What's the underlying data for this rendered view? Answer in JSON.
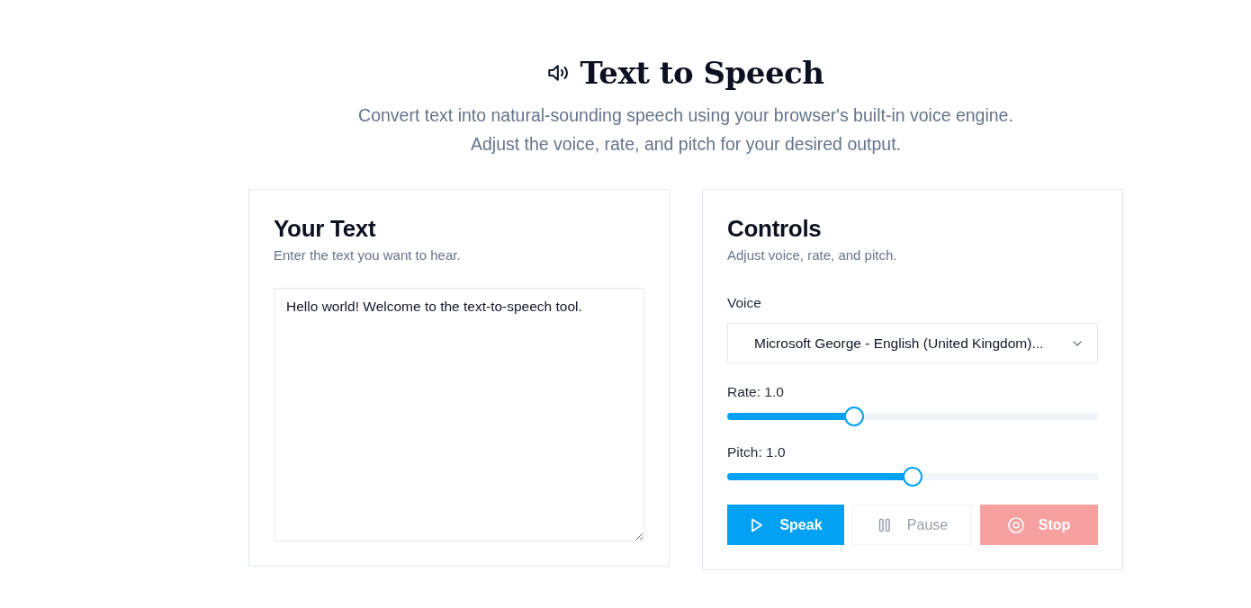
{
  "header": {
    "title": "Text to Speech",
    "subtitle": "Convert text into natural-sounding speech using your browser's built-in voice engine. Adjust the voice, rate, and pitch for your desired output."
  },
  "text_panel": {
    "title": "Your Text",
    "description": "Enter the text you want to hear.",
    "text": "Hello world! Welcome to the text-to-speech tool."
  },
  "controls_panel": {
    "title": "Controls",
    "description": "Adjust voice, rate, and pitch.",
    "voice": {
      "label": "Voice",
      "value": "Microsoft George - English (United Kingdom)..."
    },
    "sliders": [
      {
        "label": "Rate: 1.0",
        "level": 0.333
      },
      {
        "label": "Pitch: 1.0",
        "level": 0.5
      }
    ],
    "buttons": [
      {
        "kind": "speak",
        "label": "Speak",
        "disabled": false
      },
      {
        "kind": "pause",
        "label": "Pause",
        "disabled": true
      },
      {
        "kind": "stop",
        "label": "Stop",
        "disabled": true
      }
    ]
  }
}
